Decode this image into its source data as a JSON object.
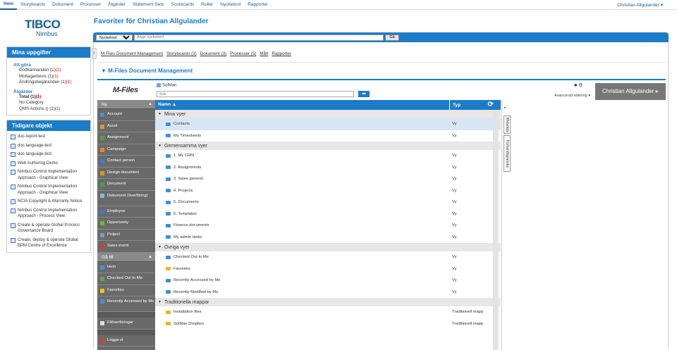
{
  "topnav": {
    "items": [
      "Hem",
      "Storyboards",
      "Dokument",
      "Processer",
      "Åtgärder",
      "Statement Sets",
      "Scorecards",
      "Roller",
      "Nyckelord",
      "Rapporter"
    ],
    "user": "Christian Allgulander ▾"
  },
  "logo": {
    "brand": "TIBCO",
    "product": "Nimbus"
  },
  "page_title": "Favoriter för Christian Allgulander",
  "search": {
    "select_value": "Nyckelord",
    "placeholder": "Ange nyckelord",
    "button": "Gå"
  },
  "tasks": {
    "title": "Mina uppgifter",
    "todo_label": "Att göra",
    "todo": [
      {
        "label": "Godkännanden",
        "a": "(1)",
        "b": "(1)"
      },
      {
        "label": "Mottagarbevis",
        "a": "(1)",
        "b": "(1)"
      },
      {
        "label": "Ändringsbegäranden",
        "a": "(1)",
        "b": "(1)"
      }
    ],
    "actions_label": "Åtgärder",
    "actions": [
      {
        "label": "Total",
        "a": "(1)",
        "b": "(1)",
        "bold": true
      },
      {
        "label": "No Category",
        "a": "",
        "b": ""
      },
      {
        "label": "QMS Actions",
        "a": "() (1)",
        "b": "(1)"
      }
    ]
  },
  "recent": {
    "title": "Tidigare objekt",
    "items": [
      "doc-report-test",
      "doc-language-test",
      "doc-language-test",
      "Web Authoring Demo",
      "Nimbus Control Implementation Approach - Graphical View",
      "Nimbus Control Implementation Approach - Graphical View",
      "NCIA Copyright & Warranty Notice",
      "Nimbus Control Implementation Approach - Process View",
      "Create & operate Global Process Governance Board",
      "Create, deploy & operate Global BPM Centre of Excellence"
    ]
  },
  "main": {
    "links": [
      "M-Files Document Management",
      "Storyboards (3)",
      "Dokument (3)",
      "Processer (5)",
      "Mått",
      "Rapporter"
    ],
    "section": "▼ M-Files Document Management"
  },
  "mfiles": {
    "logo": "M-Files",
    "vault": "SolMan",
    "search_placeholder": "Sök",
    "go": "➡",
    "tools": "■ ⚙",
    "advanced": "Avancerad sökning ▾",
    "user": "Christian Allgulander ▸",
    "nav_new_title": "Ny",
    "nav_new": [
      {
        "label": "Account",
        "color": "#4b8ed3"
      },
      {
        "label": "Asset",
        "color": "#c8a13b"
      },
      {
        "label": "Assignment",
        "color": "#5a9f4a"
      },
      {
        "label": "Campaign",
        "color": "#e0892d"
      },
      {
        "label": "Contact person",
        "color": "#3d7cc8"
      },
      {
        "label": "Design document",
        "color": "#d49a1d"
      },
      {
        "label": "Document",
        "color": "#3da346"
      },
      {
        "label": "Dokument (överföring)",
        "color": "#8fb3d9"
      },
      {
        "label": "Employee",
        "color": "#3d7cc8"
      },
      {
        "label": "Opportunity",
        "color": "#6bb53a"
      },
      {
        "label": "Project",
        "color": "#7d9dbf"
      },
      {
        "label": "Sales event",
        "color": "#c94040"
      }
    ],
    "nav_goto_title": "Gå till",
    "nav_goto": [
      {
        "label": "Hem",
        "color": "#4b8ed3"
      },
      {
        "label": "Checked Out to Me",
        "color": "#5aa84a"
      },
      {
        "label": "Favorites",
        "color": "#f0c419"
      },
      {
        "label": "Recently Accessed by Me",
        "color": "#4b8ed3"
      }
    ],
    "nav_transfer": "Filöverföringar",
    "nav_logout": "Logga ut",
    "grid_col_name": "Namn ▲",
    "grid_col_type": "Typ",
    "rows": [
      {
        "kind": "group",
        "label": "Mina vyer"
      },
      {
        "kind": "row",
        "name": "Contacts",
        "type": "Vy",
        "sel": true,
        "folder": "blue"
      },
      {
        "kind": "row",
        "name": "My Timesheets",
        "type": "Vy",
        "folder": "blue"
      },
      {
        "kind": "group",
        "label": "Gemensamma vyer"
      },
      {
        "kind": "row",
        "name": "1. My CRM",
        "type": "Vy",
        "folder": "blue"
      },
      {
        "kind": "row",
        "name": "2. Assignments",
        "type": "Vy",
        "folder": "blue"
      },
      {
        "kind": "row",
        "name": "3. Sales general",
        "type": "Vy",
        "folder": "blue"
      },
      {
        "kind": "row",
        "name": "4. Projects",
        "type": "Vy",
        "folder": "blue"
      },
      {
        "kind": "row",
        "name": "5. Documents",
        "type": "Vy",
        "folder": "blue"
      },
      {
        "kind": "row",
        "name": "6. Templates",
        "type": "Vy",
        "folder": "blue"
      },
      {
        "kind": "row",
        "name": "Finance documents",
        "type": "Vy",
        "folder": "blue"
      },
      {
        "kind": "row",
        "name": "My admin tasks",
        "type": "Vy",
        "folder": "blue"
      },
      {
        "kind": "group",
        "label": "Övriga vyer"
      },
      {
        "kind": "row",
        "name": "Checked Out to Me",
        "type": "Vy",
        "folder": "blue"
      },
      {
        "kind": "row",
        "name": "Favorites",
        "type": "Vy",
        "folder": "yel"
      },
      {
        "kind": "row",
        "name": "Recently Accessed by Me",
        "type": "Vy",
        "folder": "blue"
      },
      {
        "kind": "row",
        "name": "Recently Modified by Me",
        "type": "Vy",
        "folder": "blue"
      },
      {
        "kind": "group",
        "label": "Traditionella mappar"
      },
      {
        "kind": "row",
        "name": "Installation files",
        "type": "Traditionell mapp",
        "folder": "yel"
      },
      {
        "kind": "row",
        "name": "SolMan Dropbox",
        "type": "Traditionell mapp",
        "folder": "yel"
      }
    ],
    "right_tabs": [
      "Metadata",
      "Förhandsgranska"
    ]
  }
}
